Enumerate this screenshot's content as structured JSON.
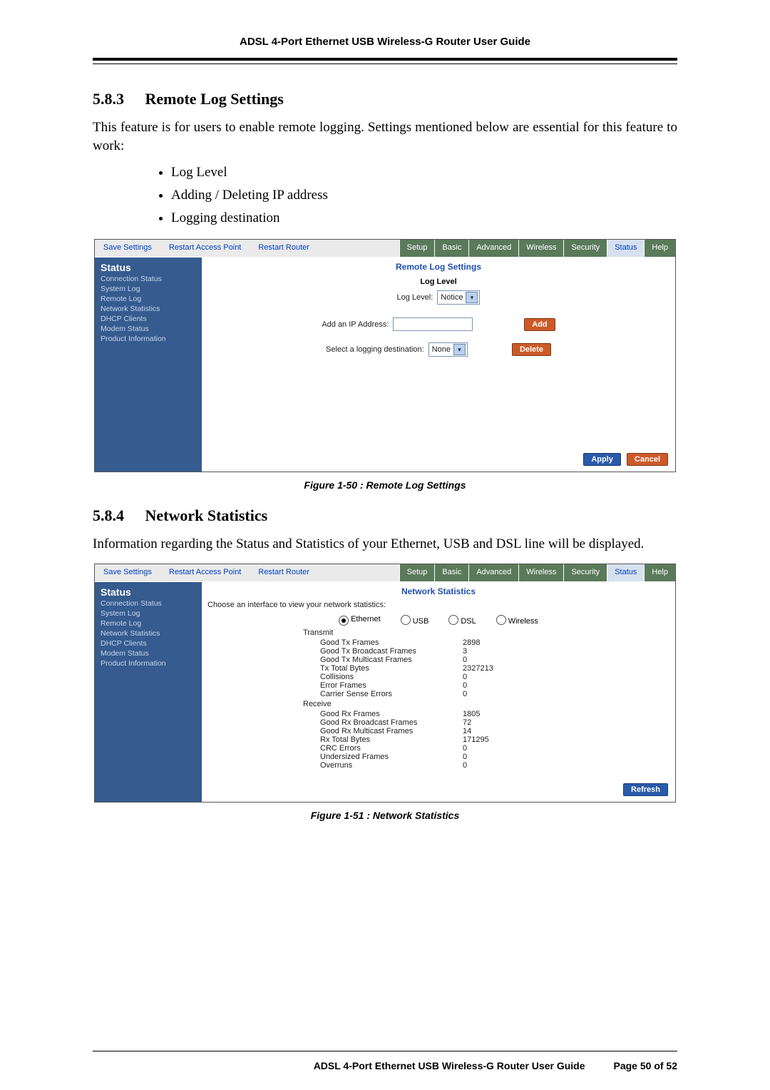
{
  "doc": {
    "header": "ADSL 4-Port Ethernet USB Wireless-G Router User Guide",
    "footer_title": "ADSL 4-Port Ethernet USB Wireless-G Router User Guide",
    "footer_page": "Page 50 of 52"
  },
  "s583": {
    "num": "5.8.3",
    "title": "Remote Log Settings",
    "para": "This feature is for users to enable remote logging. Settings mentioned below are essential for this feature to work:",
    "bullets": [
      "Log Level",
      "Adding / Deleting IP address",
      "Logging destination"
    ],
    "caption": "Figure 1-50 : Remote Log Settings"
  },
  "s584": {
    "num": "5.8.4",
    "title": "Network Statistics",
    "para": "Information regarding the Status and Statistics of your Ethernet, USB and DSL line will be displayed.",
    "caption": "Figure 1-51 : Network Statistics"
  },
  "router": {
    "links": {
      "save": "Save Settings",
      "rap": "Restart Access Point",
      "rr": "Restart Router"
    },
    "tabs": {
      "setup": "Setup",
      "basic": "Basic",
      "advanced": "Advanced",
      "wireless": "Wireless",
      "security": "Security",
      "status": "Status",
      "help": "Help"
    },
    "side": {
      "title": "Status",
      "items": [
        "Connection Status",
        "System Log",
        "Remote Log",
        "Network Statistics",
        "DHCP Clients",
        "Modem Status",
        "Product Information"
      ]
    }
  },
  "remote": {
    "title": "Remote Log Settings",
    "loglevel_header": "Log Level",
    "loglevel_label": "Log Level:",
    "loglevel_value": "Notice",
    "addip_label": "Add an IP Address:",
    "add_btn": "Add",
    "dest_label": "Select a logging destination:",
    "dest_value": "None",
    "delete_btn": "Delete",
    "apply": "Apply",
    "cancel": "Cancel"
  },
  "netstat": {
    "title": "Network Statistics",
    "choose": "Choose an interface to view your network statistics:",
    "ifaces": {
      "eth": "Ethernet",
      "usb": "USB",
      "dsl": "DSL",
      "wl": "Wireless"
    },
    "tx_hdr": "Transmit",
    "rx_hdr": "Receive",
    "tx": [
      {
        "k": "Good Tx Frames",
        "v": "2898"
      },
      {
        "k": "Good Tx Broadcast Frames",
        "v": "3"
      },
      {
        "k": "Good Tx Multicast Frames",
        "v": "0"
      },
      {
        "k": "Tx Total Bytes",
        "v": "2327213"
      },
      {
        "k": "Collisions",
        "v": "0"
      },
      {
        "k": "Error Frames",
        "v": "0"
      },
      {
        "k": "Carrier Sense Errors",
        "v": "0"
      }
    ],
    "rx": [
      {
        "k": "Good Rx Frames",
        "v": "1805"
      },
      {
        "k": "Good Rx Broadcast Frames",
        "v": "72"
      },
      {
        "k": "Good Rx Multicast Frames",
        "v": "14"
      },
      {
        "k": "Rx Total Bytes",
        "v": "171295"
      },
      {
        "k": "CRC Errors",
        "v": "0"
      },
      {
        "k": "Undersized Frames",
        "v": "0"
      },
      {
        "k": "Overruns",
        "v": "0"
      }
    ],
    "refresh": "Refresh"
  }
}
